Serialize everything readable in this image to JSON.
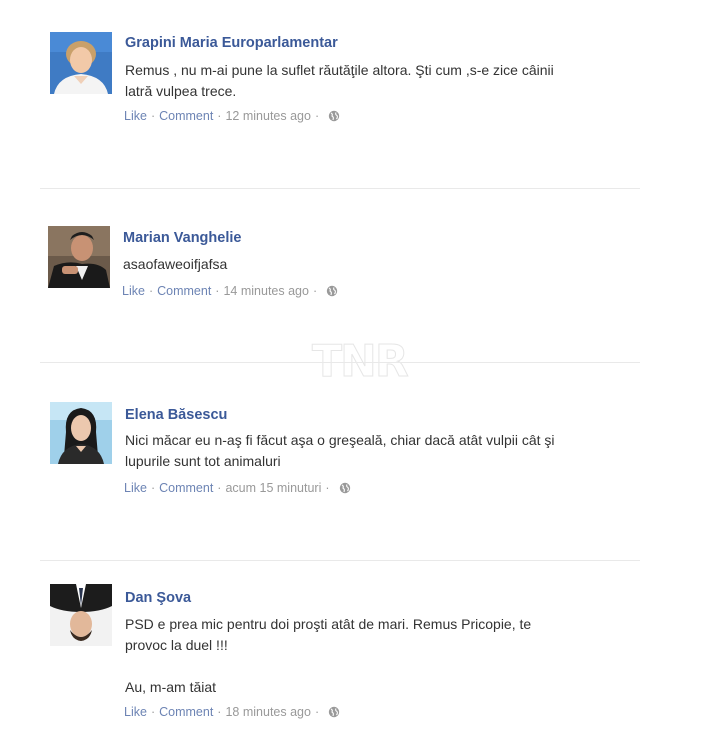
{
  "watermark": "TNR",
  "actions": {
    "like": "Like",
    "comment": "Comment",
    "separator": "·"
  },
  "comments": [
    {
      "author": "Grapini Maria Europarlamentar",
      "lines": [
        "Remus , nu m-ai pune la suflet răutăţile altora. Şti cum ,s-e zice câinii",
        "latră vulpea trece."
      ],
      "paragraphs": [],
      "time": "12 minutes ago",
      "avatar_icon": "profile-photo"
    },
    {
      "author": "Marian Vanghelie",
      "lines": [
        "asaofaweoifjafsa"
      ],
      "paragraphs": [],
      "time": "14 minutes ago",
      "avatar_icon": "profile-photo"
    },
    {
      "author": "Elena Băsescu",
      "lines": [
        "Nici măcar eu n-aş fi făcut aşa o greşeală, chiar dacă atât vulpii cât şi",
        "lupurile sunt tot animaluri"
      ],
      "paragraphs": [],
      "time": "acum 15 minuturi",
      "avatar_icon": "profile-photo"
    },
    {
      "author": "Dan Şova",
      "lines": [
        "PSD e prea mic pentru doi proşti atât de mari. Remus Pricopie, te",
        "provoc la duel !!!"
      ],
      "extra_line": "Au, m-am tăiat",
      "time": "18 minutes ago",
      "avatar_icon": "profile-photo-upside-down"
    }
  ],
  "colors": {
    "author": "#3b5998",
    "link": "#6d84b4",
    "meta": "#999999",
    "text": "#333333",
    "divider": "#e9e9e9"
  }
}
